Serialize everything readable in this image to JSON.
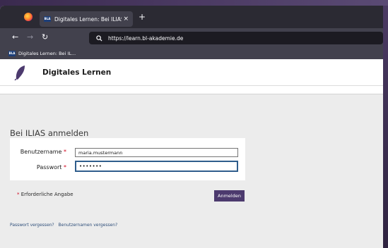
{
  "browser": {
    "tab_title": "Digitales Lernen: Bei ILIAS anm",
    "tab_close": "×",
    "new_tab": "+",
    "url": "https://learn.bl-akademie.de",
    "bookmark_label": "Digitales Lernen: Bei IL...",
    "favicon_text": "BLA",
    "icons": {
      "back": "←",
      "forward": "→",
      "reload": "↻",
      "search": "🔍"
    }
  },
  "site": {
    "title": "Digitales Lernen",
    "brand_color": "#4c3a6e"
  },
  "login": {
    "heading": "Bei ILIAS anmelden",
    "username_label": "Benutzername",
    "password_label": "Passwort",
    "required_marker": "*",
    "username_value": "maria.mustermann",
    "password_value": "•••••••",
    "required_note": "Erforderliche Angabe",
    "submit_label": "Anmelden"
  },
  "links": {
    "forgot_password": "Passwort vergessen?",
    "forgot_username": "Benutzernamen vergessen?"
  }
}
